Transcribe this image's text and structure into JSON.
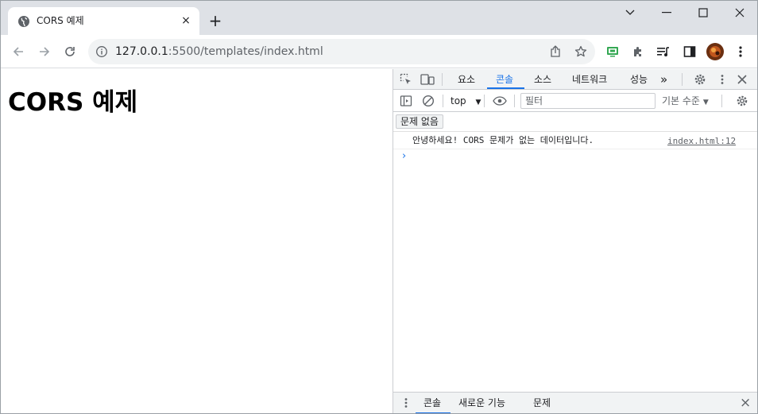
{
  "tab": {
    "title": "CORS 예제",
    "favicon": "globe-icon",
    "close": "×"
  },
  "new_tab_label": "+",
  "window_controls": {
    "minimize": "minimize-icon",
    "maximize": "maximize-icon",
    "close": "close-icon"
  },
  "toolbar": {
    "back": "back-arrow-icon",
    "forward": "forward-arrow-icon",
    "reload": "reload-icon",
    "url_host": "127.0.0.1",
    "url_path": ":5500/templates/index.html",
    "share": "share-icon",
    "bookmark": "star-icon",
    "extensions": [
      "screen-extension-icon",
      "puzzle-icon",
      "reading-list-icon",
      "side-panel-icon",
      "profile-avatar"
    ],
    "menu": "kebab-menu-icon"
  },
  "page": {
    "heading": "CORS 예제"
  },
  "devtools": {
    "tabs": [
      {
        "label": "요소",
        "active": false
      },
      {
        "label": "콘솔",
        "active": true
      },
      {
        "label": "소스",
        "active": false
      },
      {
        "label": "네트워크",
        "active": false
      },
      {
        "label": "성능",
        "active": false
      }
    ],
    "more_tabs": "»",
    "context": "top",
    "filter_placeholder": "필터",
    "levels": "기본 수준",
    "issues_button": "문제 없음",
    "messages": [
      {
        "text": "안녕하세요! CORS 문제가 없는 데이터입니다.",
        "source": "index.html:12"
      }
    ],
    "prompt": "›",
    "drawer_tabs": [
      {
        "label": "콘솔",
        "active": true
      },
      {
        "label": "새로운 기능",
        "active": false
      },
      {
        "label": "문제",
        "active": false
      }
    ],
    "drawer_close": "×",
    "accent": "#1a73e8"
  }
}
